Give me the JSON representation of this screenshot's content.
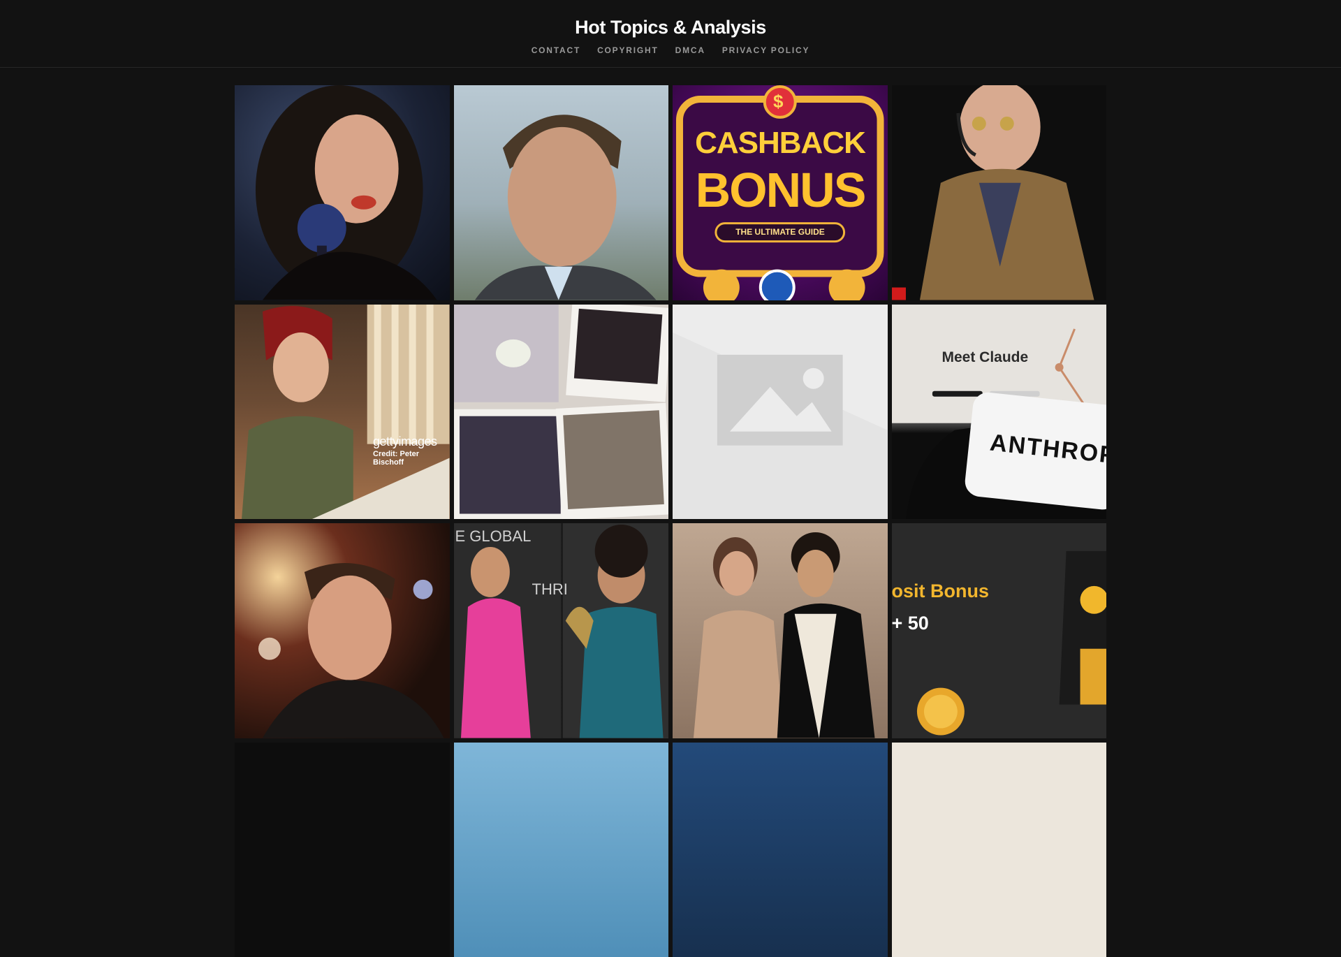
{
  "site": {
    "title": "Hot Topics & Analysis"
  },
  "nav": [
    {
      "label": "CONTACT"
    },
    {
      "label": "COPYRIGHT"
    },
    {
      "label": "DMCA"
    },
    {
      "label": "PRIVACY POLICY"
    }
  ],
  "tiles": [
    {
      "name": "woman-singing-photo"
    },
    {
      "name": "man-portrait-photo"
    },
    {
      "name": "cashback-bonus-graphic",
      "line1": "CASHBACK",
      "line2": "BONUS",
      "line3": "THE ULTIMATE GUIDE",
      "badge": "$"
    },
    {
      "name": "man-headset-photo"
    },
    {
      "name": "woman-drawing-photo",
      "watermark": "gettyimages",
      "credit": "Credit: Peter Bischoff"
    },
    {
      "name": "wedding-polaroids-photo"
    },
    {
      "name": "image-placeholder"
    },
    {
      "name": "anthropic-phone-photo",
      "heading": "Meet Claude",
      "phone_text": "ANTHROP"
    },
    {
      "name": "man-portrait-lights-photo"
    },
    {
      "name": "couple-event-collage-photo",
      "sign_text": "E GLOBAL",
      "sign_text_2": "THRI"
    },
    {
      "name": "couple-formal-photo"
    },
    {
      "name": "deposit-bonus-graphic",
      "line1": "osit Bonus",
      "line2": "+ 50"
    },
    {
      "name": "dark-photo"
    },
    {
      "name": "sky-photo"
    },
    {
      "name": "blue-photo"
    },
    {
      "name": "map-photo"
    }
  ],
  "colors": {
    "background": "#121212",
    "title": "#ffffff",
    "nav": "#9a9a9a"
  }
}
